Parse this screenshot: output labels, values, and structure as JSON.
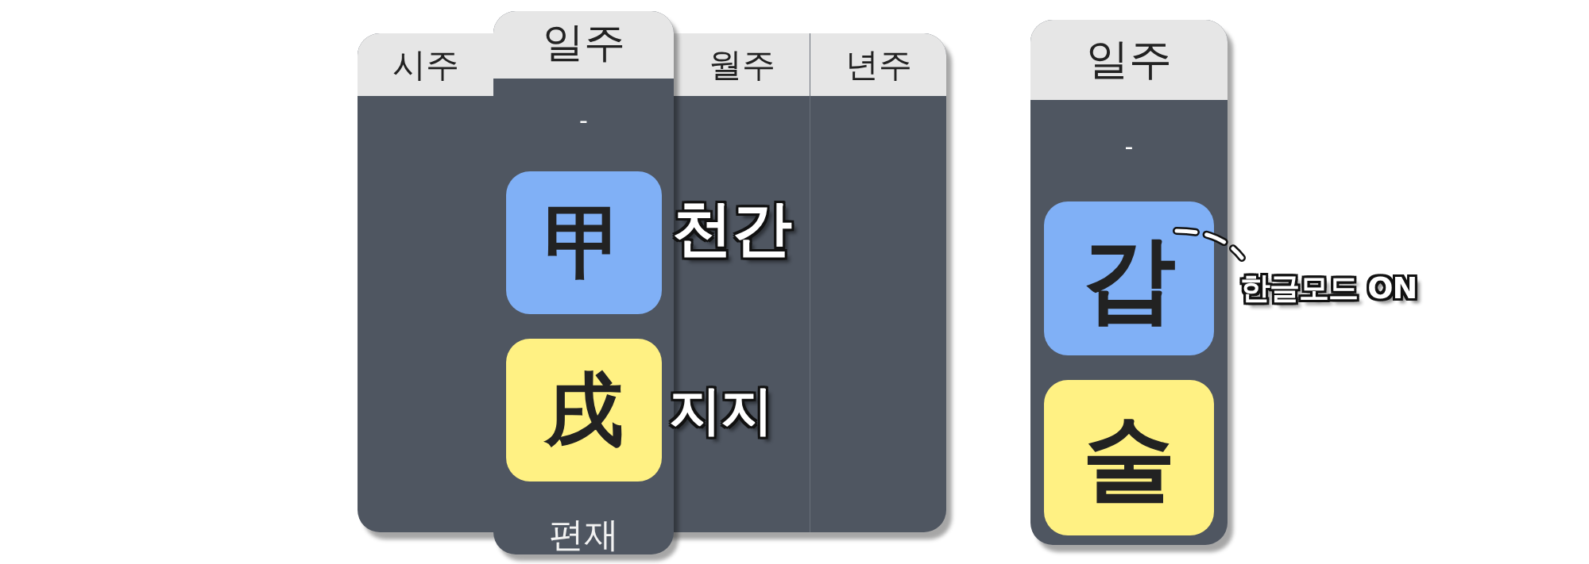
{
  "pillar_table": {
    "columns": [
      {
        "label": "시주",
        "selected": false
      },
      {
        "label": "일주",
        "selected": true,
        "top_label": "-",
        "characters": [
          {
            "char": "甲",
            "color": "#80b0f6"
          },
          {
            "char": "戌",
            "color": "#fff183"
          }
        ],
        "bottom_label": "편재"
      },
      {
        "label": "월주",
        "selected": false
      },
      {
        "label": "년주",
        "selected": false
      }
    ]
  },
  "annotations": [
    "천간",
    "지지"
  ],
  "hangul_card": {
    "label": "일주",
    "top_label": "-",
    "characters": [
      {
        "char": "갑",
        "color": "#80b0f6"
      },
      {
        "char": "술",
        "color": "#fff183"
      }
    ]
  },
  "hangul_note": "한글모드 ON"
}
